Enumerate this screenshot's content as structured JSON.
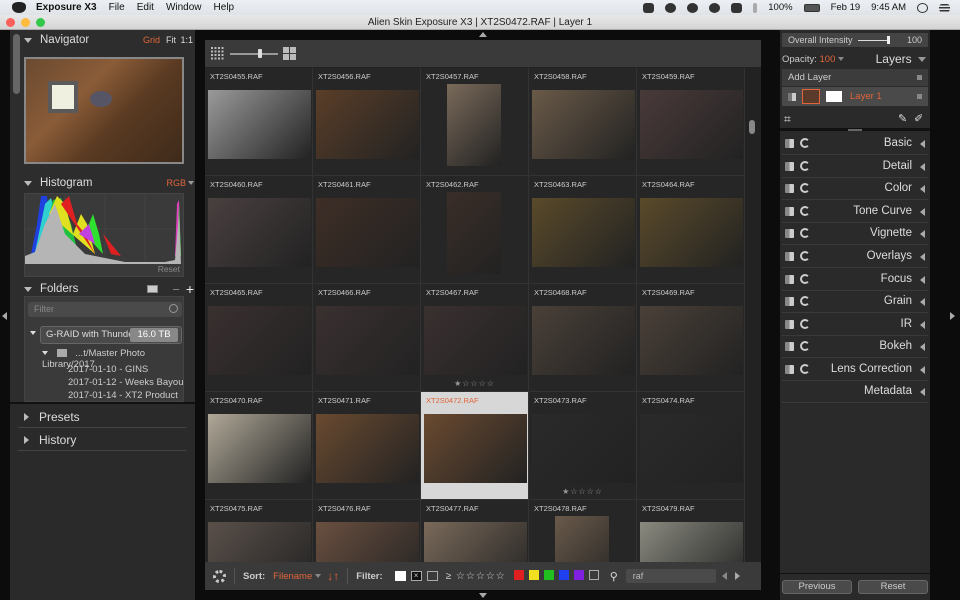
{
  "menubar": {
    "app_name": "Exposure X3",
    "menus": [
      "File",
      "Edit",
      "Window",
      "Help"
    ],
    "status": {
      "battery": "100%",
      "date": "Feb 19",
      "time": "9:45 AM"
    }
  },
  "window": {
    "title": "Alien Skin Exposure X3 | XT2S0472.RAF | Layer 1"
  },
  "left_panel": {
    "navigator": {
      "title": "Navigator",
      "modes": [
        "Grid",
        "Fit",
        "1:1"
      ],
      "active_mode": "Grid"
    },
    "histogram": {
      "title": "Histogram",
      "channel": "RGB",
      "reset_label": "Reset"
    },
    "folders": {
      "title": "Folders",
      "filter_placeholder": "Filter",
      "drive": {
        "name": "G-RAID with Thundert",
        "size": "16.0 TB"
      },
      "root": "...t/Master Photo Library/2017",
      "children": [
        "2017-01-10 - GINS",
        "2017-01-12 - Weeks Bayou",
        "2017-01-14 - XT2 Product"
      ]
    },
    "presets_label": "Presets",
    "history_label": "History"
  },
  "grid": {
    "selected": "XT2S0472.RAF",
    "items": [
      {
        "name": "XT2S0455.RAF",
        "color": "#9a9a9a",
        "shape": "land",
        "stars": ""
      },
      {
        "name": "XT2S0456.RAF",
        "color": "#5a3e28",
        "shape": "land",
        "stars": ""
      },
      {
        "name": "XT2S0457.RAF",
        "color": "#7a6a5a",
        "shape": "port",
        "stars": ""
      },
      {
        "name": "XT2S0458.RAF",
        "color": "#6a5a48",
        "shape": "land",
        "stars": ""
      },
      {
        "name": "XT2S0459.RAF",
        "color": "#4a3a3a",
        "shape": "land",
        "stars": ""
      },
      {
        "name": "XT2S0460.RAF",
        "color": "#4a4040",
        "shape": "land",
        "stars": ""
      },
      {
        "name": "XT2S0461.RAF",
        "color": "#3e2e26",
        "shape": "land",
        "stars": ""
      },
      {
        "name": "XT2S0462.RAF",
        "color": "#3a2e28",
        "shape": "port",
        "stars": ""
      },
      {
        "name": "XT2S0463.RAF",
        "color": "#5a4a2a",
        "shape": "land",
        "stars": ""
      },
      {
        "name": "XT2S0464.RAF",
        "color": "#5a4a2a",
        "shape": "land",
        "stars": ""
      },
      {
        "name": "XT2S0465.RAF",
        "color": "#3a3030",
        "shape": "land",
        "stars": ""
      },
      {
        "name": "XT2S0466.RAF",
        "color": "#3a3030",
        "shape": "land",
        "stars": ""
      },
      {
        "name": "XT2S0467.RAF",
        "color": "#3a3030",
        "shape": "land",
        "stars": "★☆☆☆☆"
      },
      {
        "name": "XT2S0468.RAF",
        "color": "#4a4038",
        "shape": "land",
        "stars": ""
      },
      {
        "name": "XT2S0469.RAF",
        "color": "#4a4038",
        "shape": "land",
        "stars": ""
      },
      {
        "name": "XT2S0470.RAF",
        "color": "#b0a898",
        "shape": "land",
        "stars": ""
      },
      {
        "name": "XT2S0471.RAF",
        "color": "#6a4a30",
        "shape": "land",
        "stars": ""
      },
      {
        "name": "XT2S0472.RAF",
        "color": "#6a4a30",
        "shape": "land",
        "stars": ""
      },
      {
        "name": "XT2S0473.RAF",
        "color": "#2a2a2a",
        "shape": "land",
        "stars": "★☆☆☆☆"
      },
      {
        "name": "XT2S0474.RAF",
        "color": "#2a2a2a",
        "shape": "land",
        "stars": ""
      },
      {
        "name": "XT2S0475.RAF",
        "color": "#5a504a",
        "shape": "land",
        "stars": ""
      },
      {
        "name": "XT2S0476.RAF",
        "color": "#6a5040",
        "shape": "land",
        "stars": ""
      },
      {
        "name": "XT2S0477.RAF",
        "color": "#7a6a5a",
        "shape": "land",
        "stars": ""
      },
      {
        "name": "XT2S0478.RAF",
        "color": "#6a5a4a",
        "shape": "port",
        "stars": ""
      },
      {
        "name": "XT2S0479.RAF",
        "color": "#8a8a80",
        "shape": "land",
        "stars": ""
      }
    ]
  },
  "bottom_bar": {
    "sort_label": "Sort:",
    "sort_value": "Filename",
    "filter_label": "Filter:",
    "rating_filter": "≥ ☆☆☆☆☆",
    "color_labels": [
      "#e02020",
      "#f0e020",
      "#20c020",
      "#2040f0",
      "#8020e0"
    ],
    "search_value": "raf"
  },
  "right_panel": {
    "overall_intensity": {
      "label": "Overall Intensity",
      "value": "100"
    },
    "opacity": {
      "label": "Opacity:",
      "value": "100"
    },
    "layers_label": "Layers",
    "add_layer_label": "Add Layer",
    "layer_name": "Layer 1",
    "adjustments": [
      "Basic",
      "Detail",
      "Color",
      "Tone Curve",
      "Vignette",
      "Overlays",
      "Focus",
      "Grain",
      "IR",
      "Bokeh",
      "Lens Correction"
    ],
    "metadata_label": "Metadata",
    "previous_label": "Previous",
    "reset_label": "Reset"
  }
}
